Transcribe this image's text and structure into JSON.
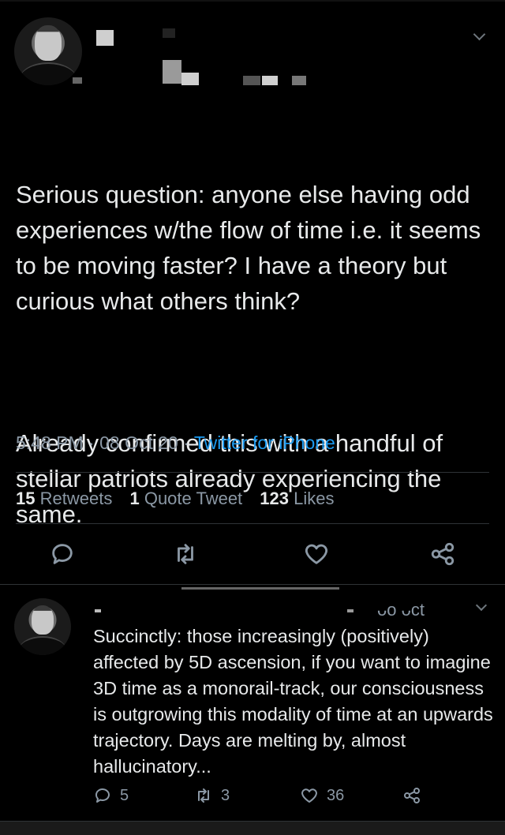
{
  "main_tweet": {
    "body_paragraphs": [
      "Serious question: anyone else having odd experiences w/the flow of time i.e. it seems to be moving faster? I have a theory but curious what others think?",
      "Already confirmed this with a handful of stellar patriots already experiencing the same."
    ],
    "time": "5:48 PM",
    "date": "08 Oct 20",
    "source": "Twitter for iPhone",
    "stats": {
      "retweets_count": "15",
      "retweets_label": "Retweets",
      "quotes_count": "1",
      "quotes_label": "Quote Tweet",
      "likes_count": "123",
      "likes_label": "Likes"
    },
    "actions": [
      "reply-icon",
      "retweet-icon",
      "like-icon",
      "share-icon"
    ]
  },
  "reply": {
    "header_date": "ᴗo ᴗct",
    "body": "Succinctly: those increasingly (positively) affected by 5D ascension, if you want to imagine 3D time as a monorail-track, our consciousness is outgrowing this modality of time at an upwards trajectory. Days are melting by, almost hallucinatory...",
    "reply_count": "5",
    "retweet_count": "3",
    "like_count": "36"
  },
  "colors": {
    "background": "#000000",
    "text": "#e7e9ea",
    "muted": "#8b98a5",
    "link": "#1d9bf0"
  }
}
